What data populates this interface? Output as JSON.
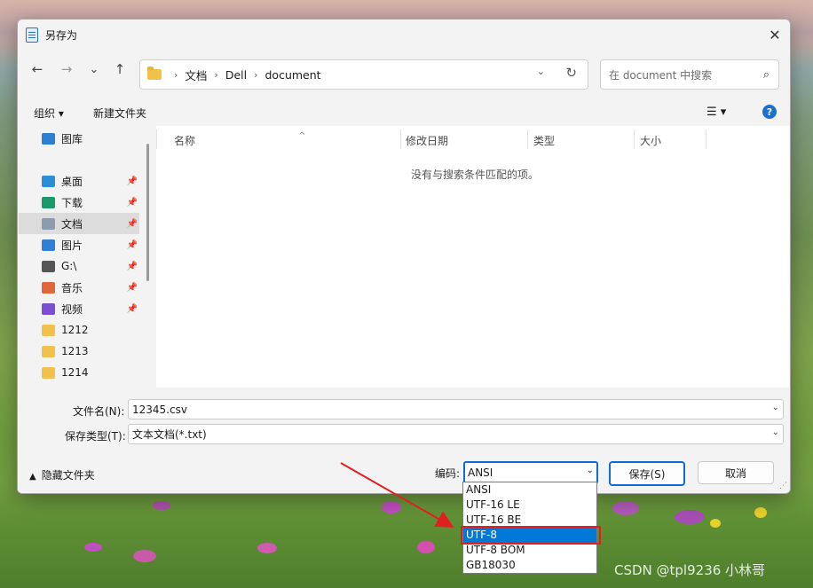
{
  "window": {
    "title": "另存为",
    "close_glyph": "✕"
  },
  "nav": {
    "back_glyph": "←",
    "forward_glyph": "→",
    "recent_glyph": "⌄",
    "up_glyph": "↑",
    "breadcrumbs": [
      "文档",
      "Dell",
      "document"
    ],
    "search_placeholder": "在 document 中搜索"
  },
  "toolbar": {
    "organize_label": "组织 ▾",
    "new_folder_label": "新建文件夹",
    "view_glyph": "☰ ▾",
    "help_glyph": "?"
  },
  "sidebar": {
    "items": [
      {
        "label": "图库",
        "icon": "gallery-icon",
        "color": "#2d7fd1",
        "pinned": false
      },
      {
        "label": "桌面",
        "icon": "desktop-icon",
        "color": "#2b8fd6",
        "pinned": true
      },
      {
        "label": "下载",
        "icon": "download-icon",
        "color": "#1a9a6a",
        "pinned": true
      },
      {
        "label": "文档",
        "icon": "document-icon",
        "color": "#8c9bb0",
        "pinned": true
      },
      {
        "label": "图片",
        "icon": "pictures-icon",
        "color": "#2f7fd5",
        "pinned": true
      },
      {
        "label": "G:\\",
        "icon": "drive-icon",
        "color": "#555555",
        "pinned": true
      },
      {
        "label": "音乐",
        "icon": "music-icon",
        "color": "#e0663c",
        "pinned": true
      },
      {
        "label": "视频",
        "icon": "video-icon",
        "color": "#7a4fd0",
        "pinned": true
      },
      {
        "label": "1212",
        "icon": "folder-icon",
        "color": "#f0c24b",
        "pinned": false
      },
      {
        "label": "1213",
        "icon": "folder-icon",
        "color": "#f0c24b",
        "pinned": false
      },
      {
        "label": "1214",
        "icon": "folder-icon",
        "color": "#f0c24b",
        "pinned": false
      }
    ],
    "active_index": 3
  },
  "filelist": {
    "columns": [
      "名称",
      "修改日期",
      "类型",
      "大小"
    ],
    "empty_message": "没有与搜索条件匹配的项。"
  },
  "form": {
    "filename_label": "文件名(N):",
    "filename_value": "12345.csv",
    "filetype_label": "保存类型(T):",
    "filetype_value": "文本文档(*.txt)",
    "hide_folders_label": "隐藏文件夹",
    "encoding_label": "编码:",
    "encoding_value": "ANSI",
    "save_label": "保存(S)",
    "cancel_label": "取消"
  },
  "encoding_options": [
    "ANSI",
    "UTF-16 LE",
    "UTF-16 BE",
    "UTF-8",
    "UTF-8 BOM",
    "GB18030"
  ],
  "highlighted_option": "UTF-8",
  "watermark": "CSDN @tpl9236 小林哥",
  "colors": {
    "accent": "#0c6cd0",
    "selection": "#0078d7",
    "annotation": "#e02020"
  }
}
